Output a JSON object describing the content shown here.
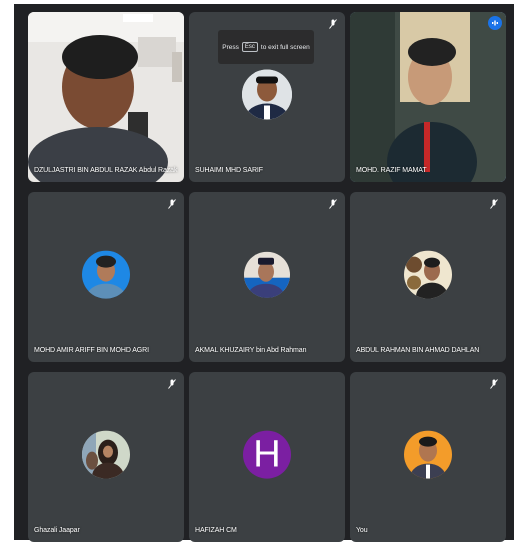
{
  "banner": {
    "press": "Press",
    "key": "Esc",
    "rest": "to exit full screen"
  },
  "participants": [
    {
      "name": "DZULJASTRI BIN ABDUL RAZAK Abdul Razak"
    },
    {
      "name": "SUHAIMI MHD SARIF"
    },
    {
      "name": "MOHD. RAZIF MAMAT"
    },
    {
      "name": "MOHD AMIR ARIFF BIN MOHD AGRI"
    },
    {
      "name": "AKMAL KHUZAIRY bin Abd Rahman"
    },
    {
      "name": "ABDUL RAHMAN BIN AHMAD DAHLAN"
    },
    {
      "name": "Ghazali Jaapar"
    },
    {
      "name": "HAFIZAH CM",
      "initial": "H"
    },
    {
      "name": "You"
    }
  ],
  "colors": {
    "stage": "#202124",
    "tile": "#3c4043",
    "active_border": "#8ab4f8",
    "avatar_purple": "#7b1fa2"
  }
}
